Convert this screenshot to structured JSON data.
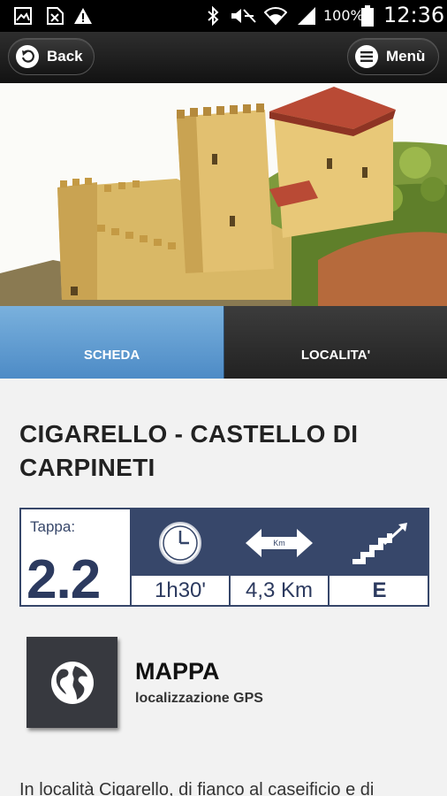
{
  "status_bar": {
    "battery_percent": "100%",
    "time": "12:36",
    "icons": [
      "gallery-icon",
      "no-sim-icon",
      "warning-icon",
      "bluetooth-icon",
      "mute-icon",
      "wifi-icon",
      "signal-icon",
      "battery-icon"
    ]
  },
  "header": {
    "back_label": "Back",
    "menu_label": "Menù"
  },
  "tabs": [
    {
      "label": "SCHEDA",
      "active": true
    },
    {
      "label": "LOCALITA'",
      "active": false
    }
  ],
  "title": "CIGARELLO - CASTELLO DI CARPINETI",
  "info": {
    "tappa_label": "Tappa:",
    "tappa_value": "2.2",
    "duration": "1h30'",
    "distance_icon_text": "Km",
    "distance": "4,3 Km",
    "difficulty": "E"
  },
  "map": {
    "title": "MAPPA",
    "subtitle": "localizzazione GPS"
  },
  "description": "In località Cigarello, di fianco al caseificio e di",
  "colors": {
    "tab_active": "#5b9bd2",
    "table_navy": "#37476a",
    "header_dark": "#1a1a1a"
  }
}
